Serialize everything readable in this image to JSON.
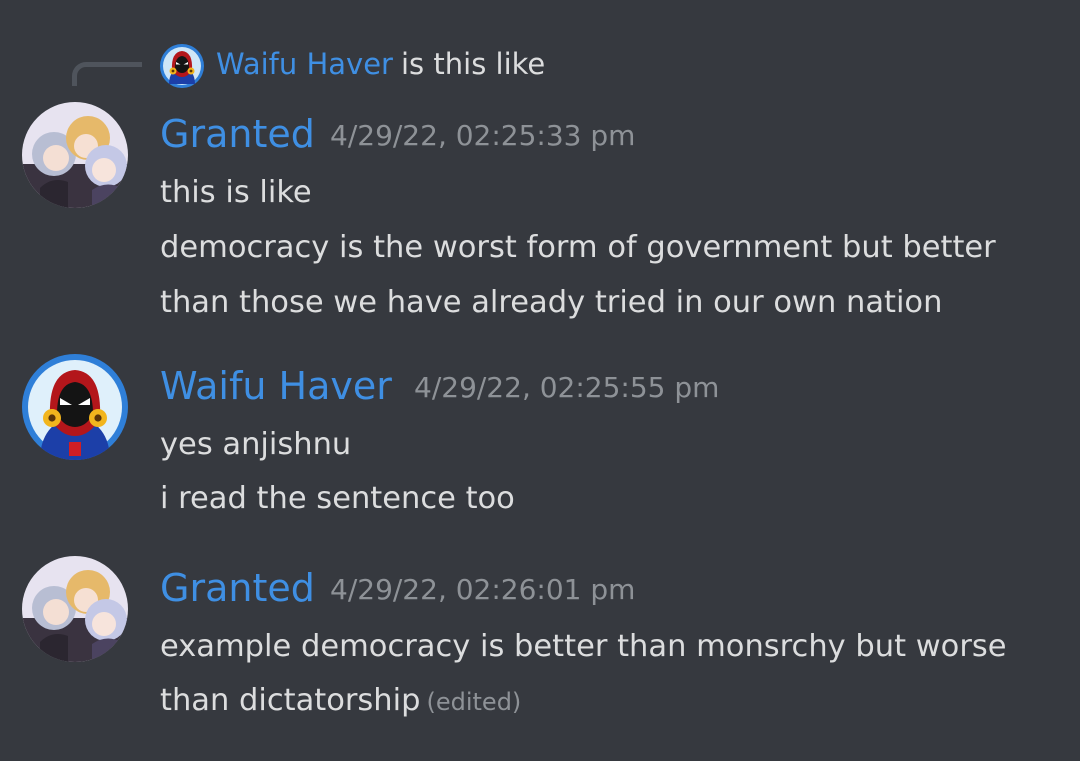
{
  "colors": {
    "background": "#36393f",
    "username": "#3f8fe3",
    "message_text": "#dcddde",
    "meta_text": "#8e9297"
  },
  "reply": {
    "author": "Waifu Haver",
    "snippet": "is this like",
    "avatar_icon": "hooded-figure-sunflower-avatar"
  },
  "messages": [
    {
      "author": "Granted",
      "timestamp": "4/29/22, 02:25:33 pm",
      "avatar_icon": "anime-group-avatar",
      "lines": [
        "this is like",
        "democracy is the worst form of government but better",
        "than those we have already tried in our own nation"
      ]
    },
    {
      "author": "Waifu Haver",
      "timestamp": "4/29/22, 02:25:55 pm",
      "avatar_icon": "hooded-figure-sunflower-avatar",
      "lines": [
        "yes anjishnu",
        "i read the sentence too"
      ]
    },
    {
      "author": "Granted",
      "timestamp": "4/29/22, 02:26:01 pm",
      "avatar_icon": "anime-group-avatar",
      "lines": [
        "example democracy is better than monsrchy but worse",
        "than dictatorship"
      ],
      "edited_label": "(edited)"
    }
  ]
}
